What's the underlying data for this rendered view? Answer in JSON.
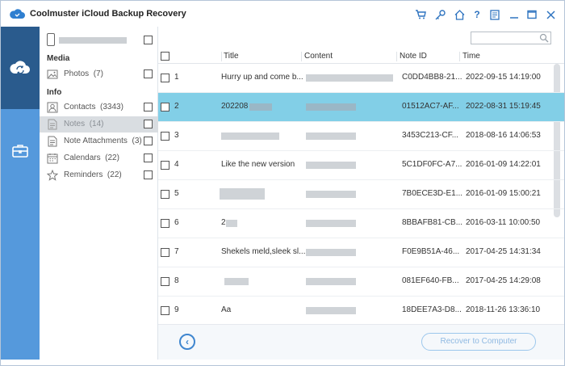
{
  "app": {
    "title": "Coolmuster iCloud Backup Recovery",
    "accent": "#5599dc",
    "nav_active": "#2a5b8d",
    "selection": "#82cfe7"
  },
  "titlebar_icons": [
    "cart-icon",
    "key-icon",
    "home-icon",
    "help-icon",
    "feedback-icon",
    "minimize-icon",
    "maximize-icon",
    "close-icon"
  ],
  "sidebar": {
    "media_label": "Media",
    "info_label": "Info",
    "media_items": [
      {
        "label": "Photos",
        "count": "(7)",
        "icon": "photo-icon"
      }
    ],
    "info_items": [
      {
        "label": "Contacts",
        "count": "(3343)",
        "icon": "contact-icon"
      },
      {
        "label": "Notes",
        "count": "(14)",
        "icon": "note-icon"
      },
      {
        "label": "Note Attachments",
        "count": "(3)",
        "icon": "attachment-icon"
      },
      {
        "label": "Calendars",
        "count": "(22)",
        "icon": "calendar-icon"
      },
      {
        "label": "Reminders",
        "count": "(22)",
        "icon": "reminder-icon"
      }
    ]
  },
  "table": {
    "headers": [
      "Title",
      "Content",
      "Note ID",
      "Time"
    ],
    "rows": [
      {
        "num": "1",
        "title": "Hurry up and come b...",
        "note_id": "C0DD4BB8-21...",
        "time": "2022-09-15 14:19:00"
      },
      {
        "num": "2",
        "title": "202208",
        "note_id": "01512AC7-AF...",
        "time": "2022-08-31 15:19:45"
      },
      {
        "num": "3",
        "title": "",
        "note_id": "3453C213-CF...",
        "time": "2018-08-16 14:06:53"
      },
      {
        "num": "4",
        "title": "Like the new version",
        "note_id": "5C1DF0FC-A7...",
        "time": "2016-01-09 14:22:01"
      },
      {
        "num": "5",
        "title": "",
        "note_id": "7B0ECE3D-E1...",
        "time": "2016-01-09 15:00:21"
      },
      {
        "num": "6",
        "title": "2",
        "note_id": "8BBAFB81-CB...",
        "time": "2016-03-11 10:00:50"
      },
      {
        "num": "7",
        "title": "Shekels meld,sleek sl...",
        "note_id": "F0E9B51A-46...",
        "time": "2017-04-25 14:31:34"
      },
      {
        "num": "8",
        "title": "",
        "note_id": "081EF640-FB...",
        "time": "2017-04-25 14:29:08"
      },
      {
        "num": "9",
        "title": "Aa",
        "note_id": "18DEE7A3-D8...",
        "time": "2018-11-26 13:36:10"
      }
    ]
  },
  "footer": {
    "recover_label": "Recover to Computer"
  }
}
